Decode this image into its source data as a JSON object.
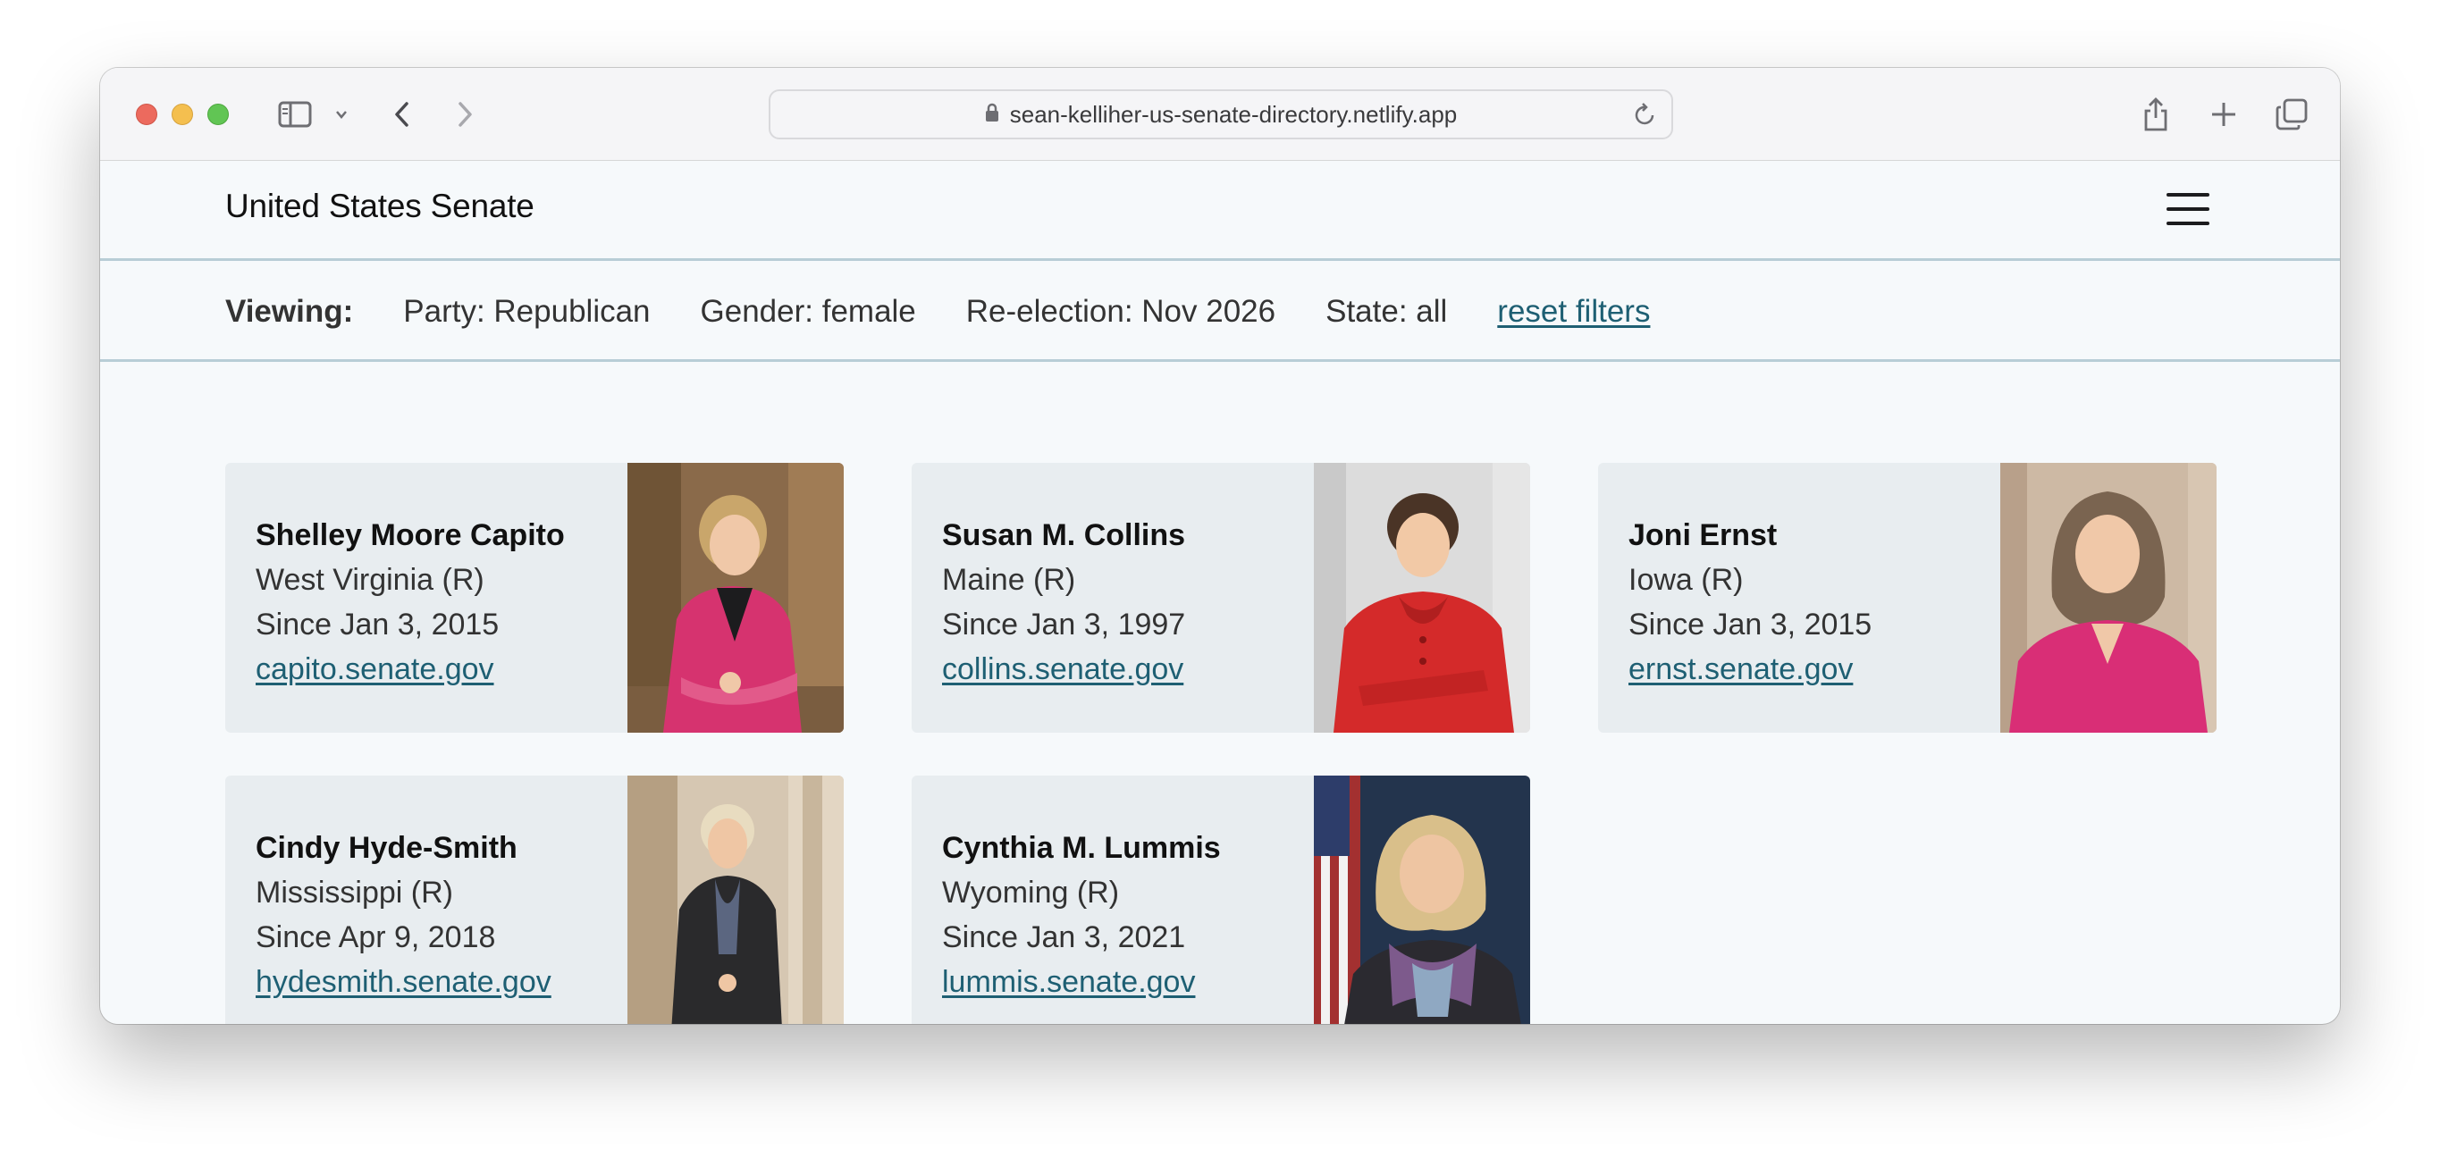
{
  "browser": {
    "url": "sean-kelliher-us-senate-directory.netlify.app"
  },
  "header": {
    "title": "United States Senate"
  },
  "filters": {
    "label": "Viewing:",
    "party": "Party: Republican",
    "gender": "Gender: female",
    "reelection": "Re-election: Nov 2026",
    "state": "State: all",
    "reset": "reset filters"
  },
  "senators": [
    {
      "name": "Shelley Moore Capito",
      "state": "West Virginia (R)",
      "since": "Since Jan 3, 2015",
      "website": "capito.senate.gov"
    },
    {
      "name": "Susan M. Collins",
      "state": "Maine (R)",
      "since": "Since Jan 3, 1997",
      "website": "collins.senate.gov"
    },
    {
      "name": "Joni Ernst",
      "state": "Iowa (R)",
      "since": "Since Jan 3, 2015",
      "website": "ernst.senate.gov"
    },
    {
      "name": "Cindy Hyde-Smith",
      "state": "Mississippi (R)",
      "since": "Since Apr 9, 2018",
      "website": "hydesmith.senate.gov"
    },
    {
      "name": "Cynthia M. Lummis",
      "state": "Wyoming (R)",
      "since": "Since Jan 3, 2021",
      "website": "lummis.senate.gov"
    }
  ],
  "colors": {
    "accent_link": "#1e5f73",
    "card_bg": "#e8edf0",
    "divider": "#b8cdd6"
  }
}
